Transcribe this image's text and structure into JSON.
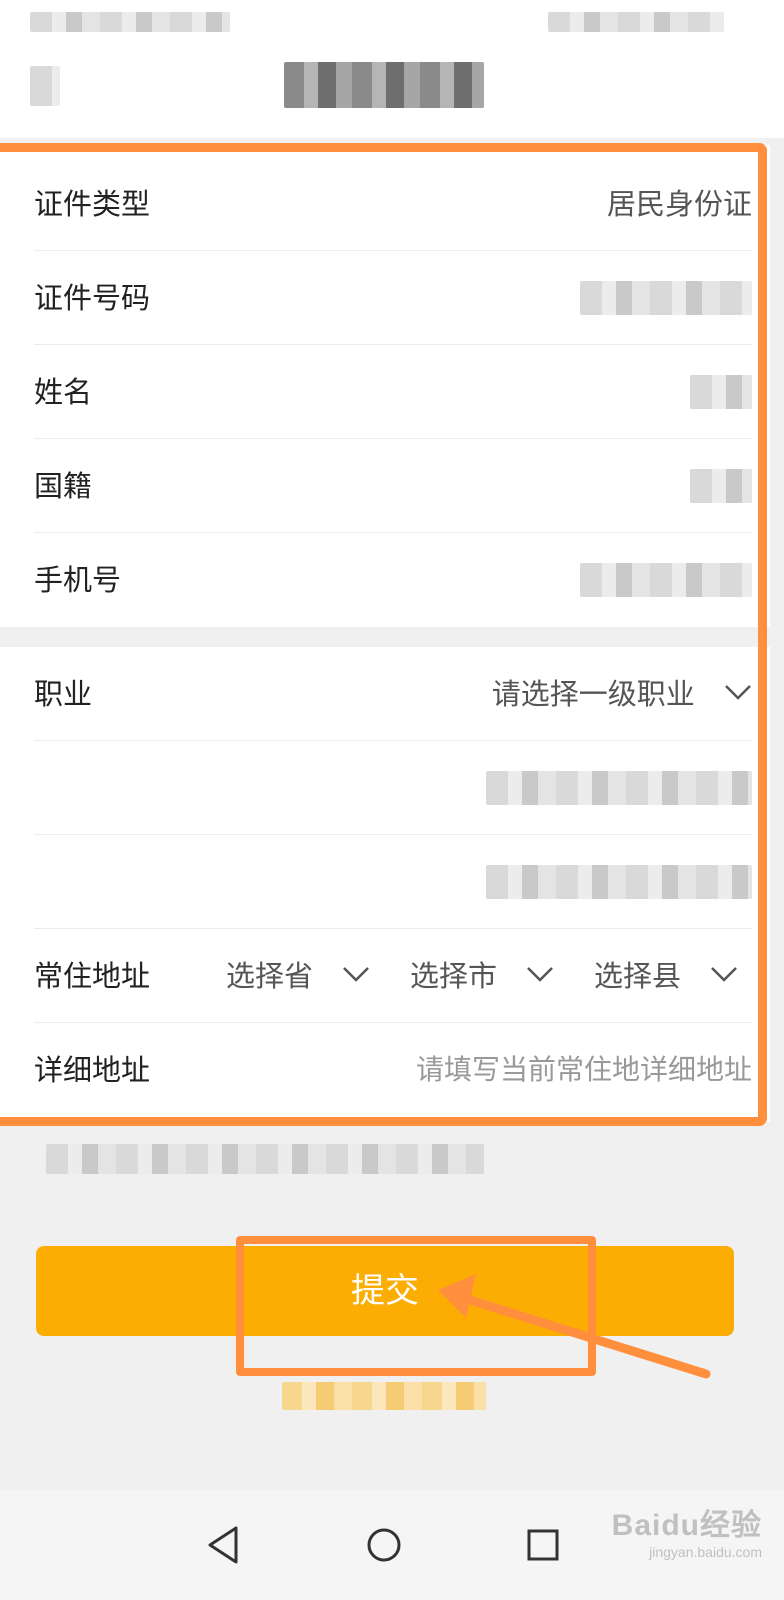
{
  "form": {
    "id_type": {
      "label": "证件类型",
      "value": "居民身份证"
    },
    "id_number": {
      "label": "证件号码"
    },
    "name": {
      "label": "姓名"
    },
    "nationality": {
      "label": "国籍"
    },
    "phone": {
      "label": "手机号"
    },
    "occupation": {
      "label": "职业",
      "placeholder": "请选择一级职业"
    },
    "address": {
      "label": "常住地址",
      "province": "选择省",
      "city": "选择市",
      "county": "选择县"
    },
    "detail_address": {
      "label": "详细地址",
      "placeholder": "请填写当前常住地详细地址"
    }
  },
  "submit": {
    "label": "提交"
  },
  "watermark": {
    "main": "Baidu经验",
    "sub": "jingyan.baidu.com"
  },
  "colors": {
    "accent": "#fbad03",
    "annotation": "#ff8f3d",
    "text": "#222222",
    "placeholder": "#999999"
  }
}
